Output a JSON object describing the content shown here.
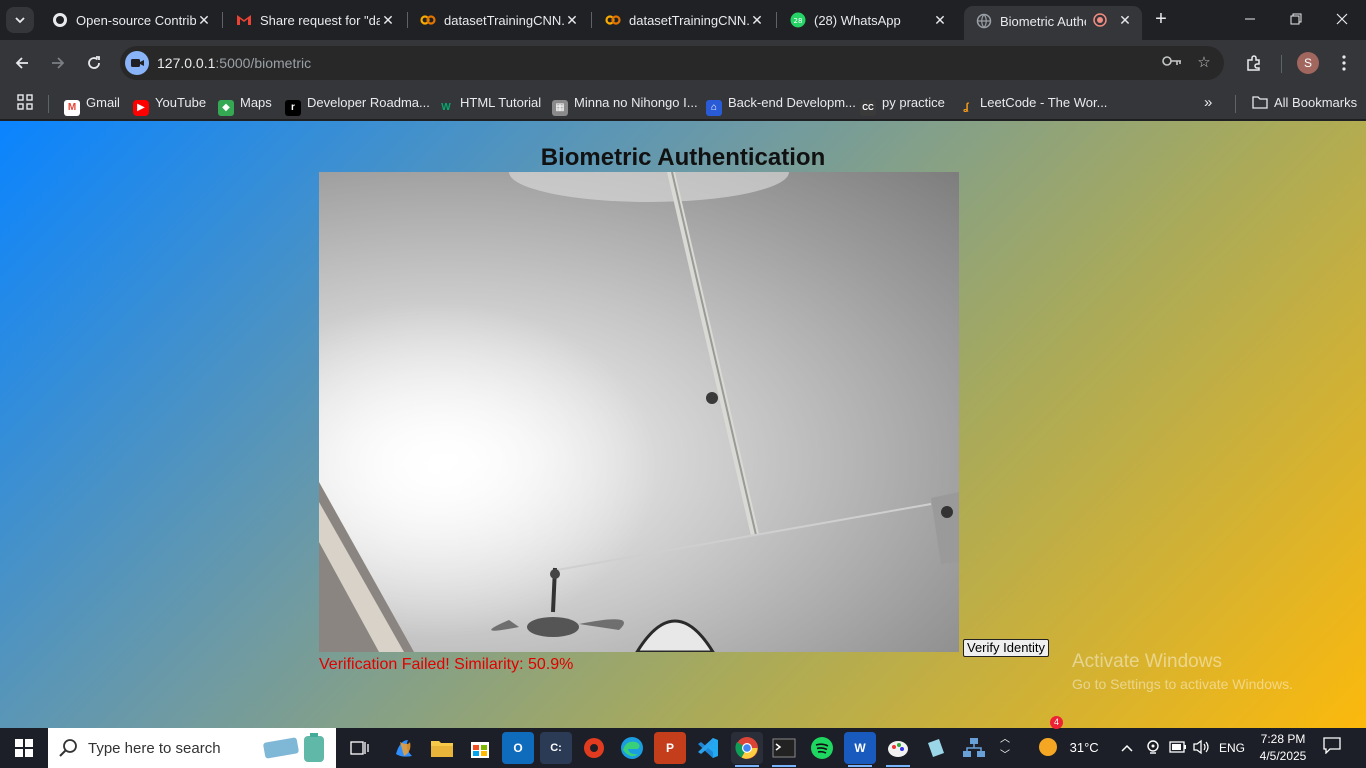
{
  "browser": {
    "tabs": [
      {
        "title": "Open-source Contributors",
        "icon": "github-icon"
      },
      {
        "title": "Share request for \"dataset\"",
        "icon": "gmail-icon"
      },
      {
        "title": "datasetTrainingCNN.ipynb",
        "icon": "colab-icon"
      },
      {
        "title": "datasetTrainingCNN.ipynb",
        "icon": "colab-icon"
      },
      {
        "title": "(28) WhatsApp",
        "icon": "whatsapp-icon"
      },
      {
        "title": "Biometric Authentication",
        "icon": "globe-icon",
        "active": true
      }
    ],
    "url_host": "127.0.0.1",
    "url_path": ":5000/biometric",
    "profile_initial": "S",
    "bookmarks": [
      {
        "label": "Gmail",
        "icon": "gmail-icon"
      },
      {
        "label": "YouTube",
        "icon": "youtube-icon"
      },
      {
        "label": "Maps",
        "icon": "maps-icon"
      },
      {
        "label": "Developer Roadma...",
        "icon": "roadmap-icon"
      },
      {
        "label": "HTML Tutorial",
        "icon": "w3schools-icon"
      },
      {
        "label": "Minna no Nihongo I...",
        "icon": "image-icon"
      },
      {
        "label": "Back-end Developm...",
        "icon": "coursera-icon"
      },
      {
        "label": "py practice",
        "icon": "cc-icon"
      },
      {
        "label": "LeetCode - The Wor...",
        "icon": "leetcode-icon"
      }
    ],
    "all_bookmarks": "All Bookmarks"
  },
  "page": {
    "title": "Biometric Authentication",
    "verify_button": "Verify Identity",
    "result_text": "Verification Failed! Similarity: 50.9%",
    "result_color": "#e00000"
  },
  "watermark": {
    "line1": "Activate Windows",
    "line2": "Go to Settings to activate Windows."
  },
  "taskbar": {
    "search_placeholder": "Type here to search",
    "weather": "31°C",
    "weather_badge": "4",
    "language": "ENG",
    "time": "7:28 PM",
    "date": "4/5/2025"
  }
}
